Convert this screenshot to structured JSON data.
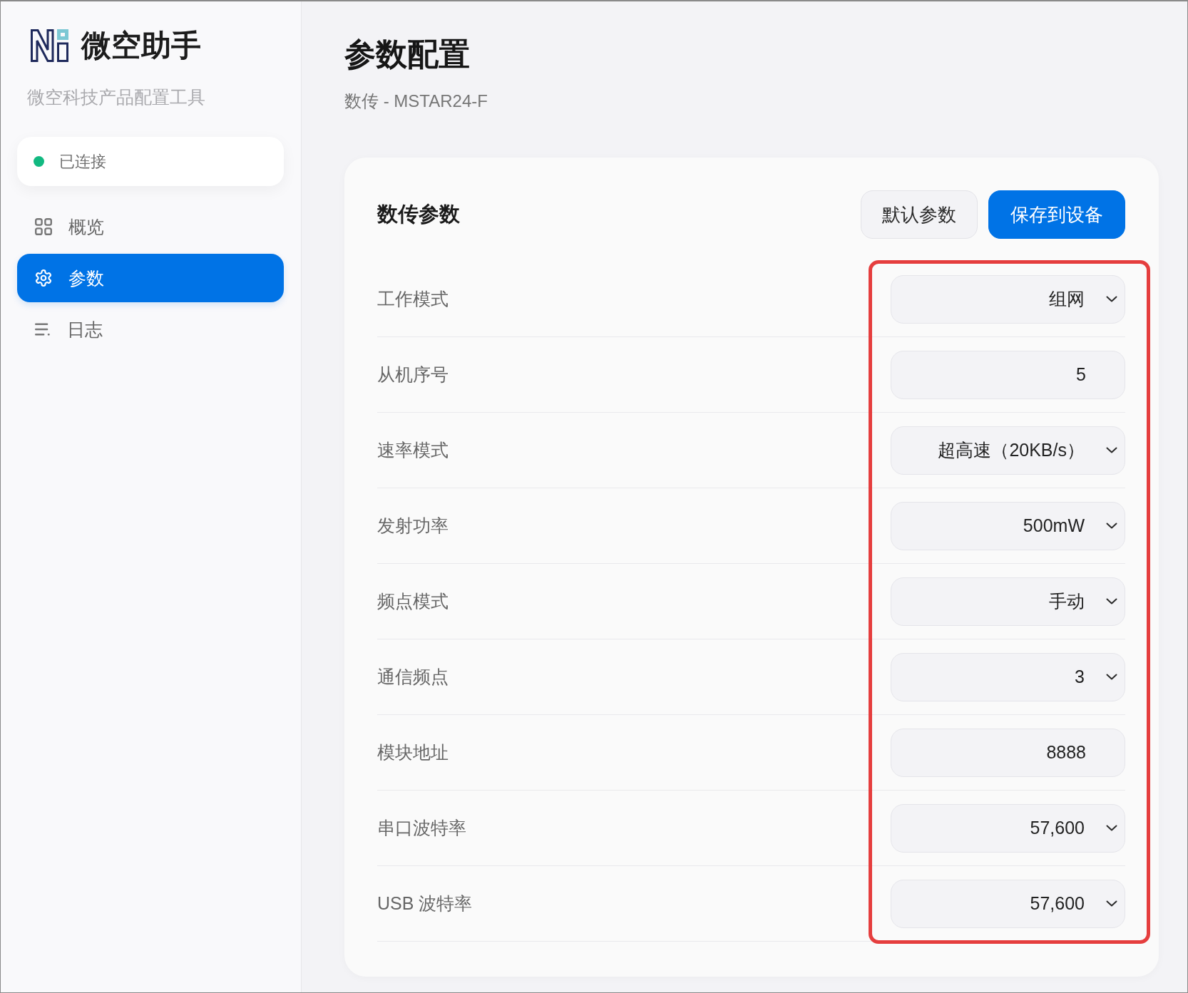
{
  "sidebar": {
    "app_name": "微空助手",
    "subtitle": "微空科技产品配置工具",
    "connection": {
      "label": "已连接",
      "connected": true
    },
    "nav": [
      {
        "label": "概览",
        "selected": false
      },
      {
        "label": "参数",
        "selected": true
      },
      {
        "label": "日志",
        "selected": false
      }
    ]
  },
  "header": {
    "title": "参数配置",
    "subtitle": "数传 - MSTAR24-F"
  },
  "panel": {
    "title": "数传参数",
    "buttons": [
      {
        "label": "默认参数",
        "kind": "secondary"
      },
      {
        "label": "保存到设备",
        "kind": "primary"
      }
    ],
    "highlight_controls": true,
    "fields": [
      {
        "label": "工作模式",
        "kind": "select",
        "value": "组网"
      },
      {
        "label": "从机序号",
        "kind": "input",
        "value": "5"
      },
      {
        "label": "速率模式",
        "kind": "select",
        "value": "超高速（20KB/s）"
      },
      {
        "label": "发射功率",
        "kind": "select",
        "value": "500mW"
      },
      {
        "label": "频点模式",
        "kind": "select",
        "value": "手动"
      },
      {
        "label": "通信频点",
        "kind": "select",
        "value": "3"
      },
      {
        "label": "模块地址",
        "kind": "input",
        "value": "8888"
      },
      {
        "label": "串口波特率",
        "kind": "select",
        "value": "57,600"
      },
      {
        "label": "USB 波特率",
        "kind": "select",
        "value": "57,600"
      }
    ]
  }
}
